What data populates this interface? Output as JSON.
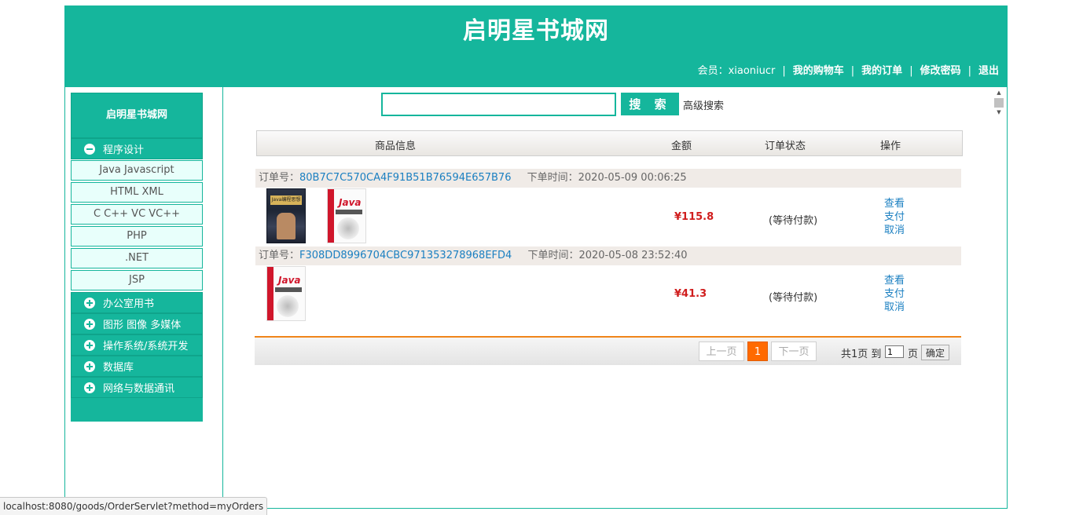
{
  "header": {
    "site_title": "启明星书城网",
    "member_label": "会员：xiaoniucr",
    "links": {
      "cart": "我的购物车",
      "orders": "我的订单",
      "password": "修改密码",
      "logout": "退出"
    },
    "separator": "|"
  },
  "sidebar": {
    "title": "启明星书城网",
    "categories": [
      {
        "label": "程序设计",
        "expanded": true,
        "items": [
          "Java Javascript",
          "HTML XML",
          "C C++ VC VC++",
          "PHP",
          ".NET",
          "JSP"
        ]
      },
      {
        "label": "办公室用书",
        "expanded": false
      },
      {
        "label": "图形 图像 多媒体",
        "expanded": false
      },
      {
        "label": "操作系统/系统开发",
        "expanded": false
      },
      {
        "label": "数据库",
        "expanded": false
      },
      {
        "label": "网络与数据通讯",
        "expanded": false
      }
    ]
  },
  "search": {
    "value": "",
    "button_label": "搜 索",
    "advanced_label": "高级搜索"
  },
  "table": {
    "headers": {
      "info": "商品信息",
      "amount": "金额",
      "status": "订单状态",
      "ops": "操作"
    }
  },
  "orders": [
    {
      "id_label": "订单号：",
      "id": "80B7C7C570CA4F91B51B76594E657B76",
      "time_label": "下单时间：",
      "time": "2020-05-09 00:06:25",
      "amount": "¥115.8",
      "status": "(等待付款)",
      "ops": [
        "查看",
        "支付",
        "取消"
      ],
      "book_cover_texts": [
        "Java编程思想",
        "Java"
      ]
    },
    {
      "id_label": "订单号：",
      "id": "F308DD8996704CBC971353278968EFD4",
      "time_label": "下单时间：",
      "time": "2020-05-08 23:52:40",
      "amount": "¥41.3",
      "status": "(等待付款)",
      "ops": [
        "查看",
        "支付",
        "取消"
      ],
      "book_cover_texts": [
        "Java"
      ]
    }
  ],
  "pager": {
    "prev": "上一页",
    "current": "1",
    "next": "下一页",
    "total_text": "共1页 到",
    "page_input_value": "1",
    "page_suffix": "页",
    "ok": "确定"
  },
  "status_bar": {
    "url": "localhost:8080/goods/OrderServlet?method=myOrders"
  },
  "colors": {
    "brand": "#15b69c",
    "price": "#d01d1d",
    "link": "#1a7fc1",
    "pager_accent": "#ff6a00"
  }
}
